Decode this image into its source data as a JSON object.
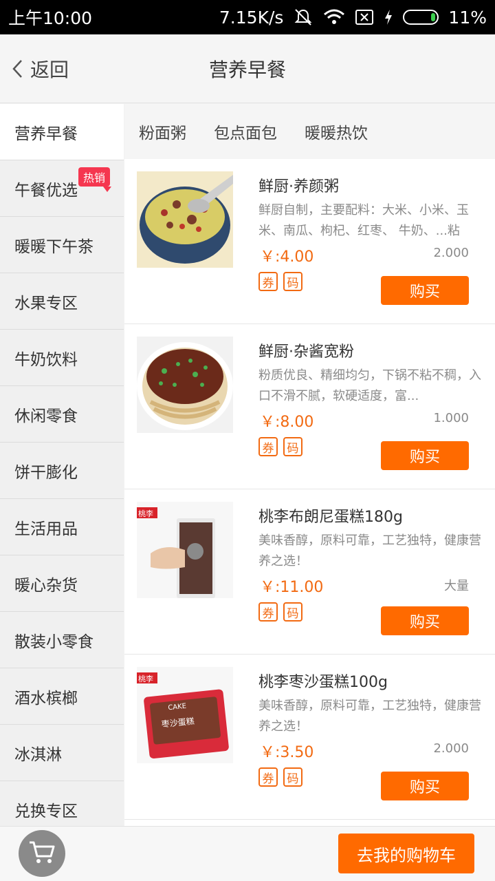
{
  "status_bar": {
    "time": "上午10:00",
    "network_speed": "7.15K/s",
    "battery": "11%"
  },
  "header": {
    "back_label": "返回",
    "title": "营养早餐"
  },
  "sidebar": {
    "items": [
      {
        "label": "营养早餐"
      },
      {
        "label": "午餐优选",
        "badge": "热销"
      },
      {
        "label": "暖暖下午茶"
      },
      {
        "label": "水果专区"
      },
      {
        "label": "牛奶饮料"
      },
      {
        "label": "休闲零食"
      },
      {
        "label": "饼干膨化"
      },
      {
        "label": "生活用品"
      },
      {
        "label": "暖心杂货"
      },
      {
        "label": "散装小零食"
      },
      {
        "label": "酒水槟榔"
      },
      {
        "label": "冰淇淋"
      },
      {
        "label": "兑换专区"
      }
    ]
  },
  "subtabs": [
    "粉面粥",
    "包点面包",
    "暖暖热饮"
  ],
  "products": [
    {
      "name": "鲜厨·养颜粥",
      "desc": "鲜厨自制，主要配料：大米、小米、玉米、南瓜、枸杞、红枣、 牛奶、...粘",
      "price": "￥:4.00",
      "qty": "2.000",
      "tag1": "券",
      "tag2": "码",
      "buy_label": "购买"
    },
    {
      "name": "鲜厨·杂酱宽粉",
      "desc": "粉质优良、精细均匀，下锅不粘不稠，入口不滑不腻，软硬适度，富...",
      "price": "￥:8.00",
      "qty": "1.000",
      "tag1": "券",
      "tag2": "码",
      "buy_label": "购买"
    },
    {
      "name": "桃李布朗尼蛋糕180g",
      "desc": "美味香醇，原料可靠，工艺独特，健康营养之选！",
      "price": "￥:11.00",
      "qty": "大量",
      "tag1": "券",
      "tag2": "码",
      "buy_label": "购买",
      "image_text": "桃李"
    },
    {
      "name": "桃李枣沙蛋糕100g",
      "desc": "美味香醇，原料可靠，工艺独特，健康营养之选！",
      "price": "￥:3.50",
      "qty": "2.000",
      "tag1": "券",
      "tag2": "码",
      "buy_label": "购买",
      "image_text": "桃李",
      "package_text": "枣沙蛋糕",
      "package_brand": "CAKE"
    }
  ],
  "bottom_bar": {
    "go_cart_label": "去我的购物车"
  },
  "colors": {
    "accent": "#ff6a00",
    "price": "#f26a12",
    "hot_badge": "#f5364f"
  }
}
